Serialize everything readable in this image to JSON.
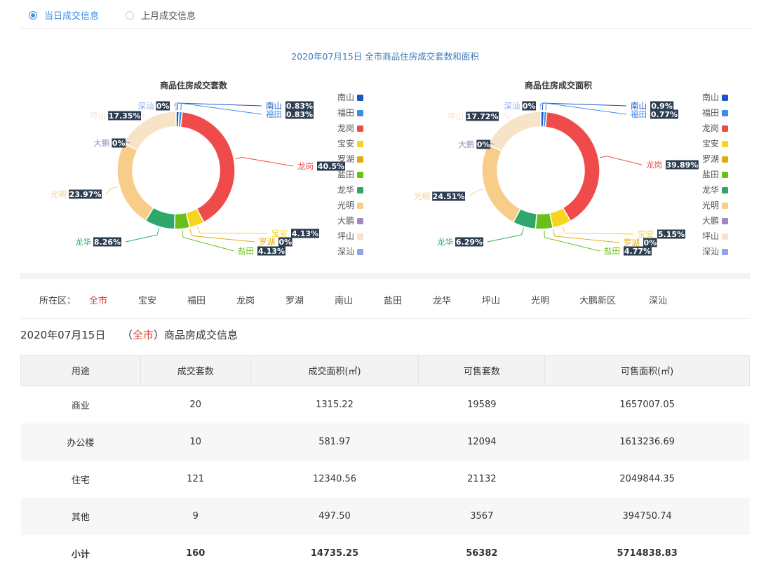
{
  "radios": [
    {
      "label": "当日成交信息",
      "active": true
    },
    {
      "label": "上月成交信息",
      "active": false
    }
  ],
  "chart_title": "2020年07月15日 全市商品住房成交套数和面积",
  "colors": {
    "南山": "#1a56c7",
    "福田": "#3b8de8",
    "龙岗": "#f04b4b",
    "宝安": "#f6d51a",
    "罗湖": "#e8a80c",
    "盐田": "#6cbf1a",
    "龙华": "#2ea86a",
    "光明": "#f8cd8a",
    "大鹏": "#a587bd",
    "坪山": "#f7e4c8",
    "深汕": "#8aa9e4"
  },
  "chart_data": [
    {
      "type": "pie",
      "title": "商品住房成交套数",
      "categories": [
        "南山",
        "福田",
        "龙岗",
        "宝安",
        "罗湖",
        "盐田",
        "龙华",
        "光明",
        "大鹏",
        "坪山",
        "深汕"
      ],
      "values": [
        0.83,
        0.83,
        40.5,
        4.13,
        0,
        4.13,
        8.26,
        23.97,
        0,
        17.35,
        0
      ],
      "labels": [
        "0.83%",
        "0.83%",
        "40.5%",
        "4.13%",
        "0%",
        "4.13%",
        "8.26%",
        "23.97%",
        "0%",
        "17.35%",
        "0%"
      ],
      "legend": "right"
    },
    {
      "type": "pie",
      "title": "商品住房成交面积",
      "categories": [
        "南山",
        "福田",
        "龙岗",
        "宝安",
        "罗湖",
        "盐田",
        "龙华",
        "光明",
        "大鹏",
        "坪山",
        "深汕"
      ],
      "values": [
        0.9,
        0.77,
        39.89,
        5.15,
        0,
        4.77,
        6.29,
        24.51,
        0,
        17.72,
        0
      ],
      "labels": [
        "0.9%",
        "0.77%",
        "39.89%",
        "5.15%",
        "0%",
        "4.77%",
        "6.29%",
        "24.51%",
        "0%",
        "17.72%",
        "0%"
      ],
      "legend": "right"
    }
  ],
  "district_filter": {
    "label": "所在区：",
    "items": [
      "全市",
      "宝安",
      "福田",
      "龙岗",
      "罗湖",
      "南山",
      "盐田",
      "龙华",
      "坪山",
      "光明",
      "大鹏新区",
      "深汕"
    ],
    "active": "全市"
  },
  "info": {
    "date": "2020年07月15日",
    "open": "（",
    "area": "全市",
    "close": "）",
    "suffix": "商品房成交信息"
  },
  "table": {
    "headers": [
      "用途",
      "成交套数",
      "成交面积(㎡)",
      "可售套数",
      "可售面积(㎡)"
    ],
    "rows": [
      [
        "商业",
        "20",
        "1315.22",
        "19589",
        "1657007.05"
      ],
      [
        "办公楼",
        "10",
        "581.97",
        "12094",
        "1613236.69"
      ],
      [
        "住宅",
        "121",
        "12340.56",
        "21132",
        "2049844.35"
      ],
      [
        "其他",
        "9",
        "497.50",
        "3567",
        "394750.74"
      ]
    ],
    "total": [
      "小计",
      "160",
      "14735.25",
      "56382",
      "5714838.83"
    ]
  }
}
